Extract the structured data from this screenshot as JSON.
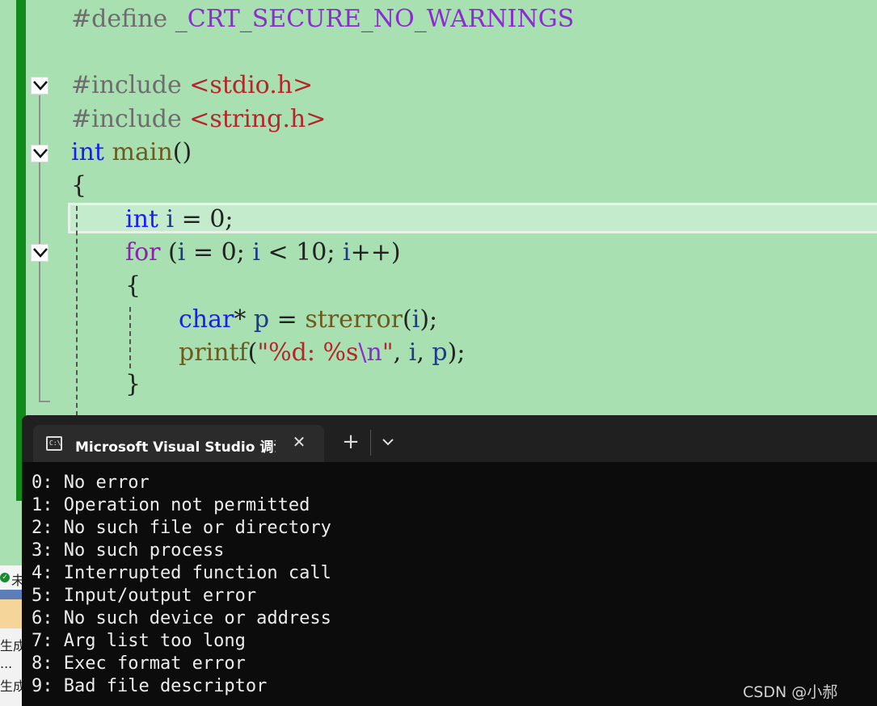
{
  "editor": {
    "lines": {
      "define_kw": "#define",
      "define_name": "_CRT_SECURE_NO_WARNINGS",
      "include1_kw": "#include",
      "include1_file": "<stdio.h>",
      "include2_kw": "#include",
      "include2_file": "<string.h>",
      "main_type": "int",
      "main_name": "main",
      "main_parens": "()",
      "open_brace": "{",
      "decl_type": "int",
      "decl_var": "i",
      "decl_rest": " = 0;",
      "for_kw": "for",
      "for_open": " (",
      "for_i1": "i",
      "for_mid1": " = 0; ",
      "for_i2": "i",
      "for_mid2": " < 10; ",
      "for_i3": "i",
      "for_end": "++)",
      "inner_open": "{",
      "char_type": "char",
      "char_star": "* ",
      "char_var": "p",
      "char_eq": " = ",
      "char_func": "strerror",
      "char_paren1": "(",
      "char_arg": "i",
      "char_paren2": ");",
      "printf_func": "printf",
      "printf_paren": "(",
      "printf_str1": "\"%d: %s",
      "printf_esc": "\\n",
      "printf_str2": "\"",
      "printf_comma1": ", ",
      "printf_arg1": "i",
      "printf_comma2": ", ",
      "printf_arg2": "p",
      "printf_end": ");",
      "inner_close": "}"
    }
  },
  "terminal": {
    "tab_title": "Microsoft Visual Studio 调试控制台",
    "tab_icon_text": "C:\\",
    "close_symbol": "✕",
    "new_tab_symbol": "+",
    "output": [
      "0: No error",
      "1: Operation not permitted",
      "2: No such file or directory",
      "3: No such process",
      "4: Interrupted function call",
      "5: Input/output error",
      "6: No such device or address",
      "7: Arg list too long",
      "8: Exec format error",
      "9: Bad file descriptor"
    ]
  },
  "underlying_panel": {
    "status_text": "未",
    "text2": "生成",
    "text3": "...",
    "text4": "生成"
  },
  "watermark": "CSDN @小郝",
  "colors": {
    "editor_bg": "#a8e0b1",
    "change_bar": "#118a1b",
    "terminal_bg": "#0c0c0c",
    "tabbar_bg": "#202020",
    "keyword": "#1a1aff",
    "function": "#6f5a1e",
    "string": "#b5262c"
  }
}
